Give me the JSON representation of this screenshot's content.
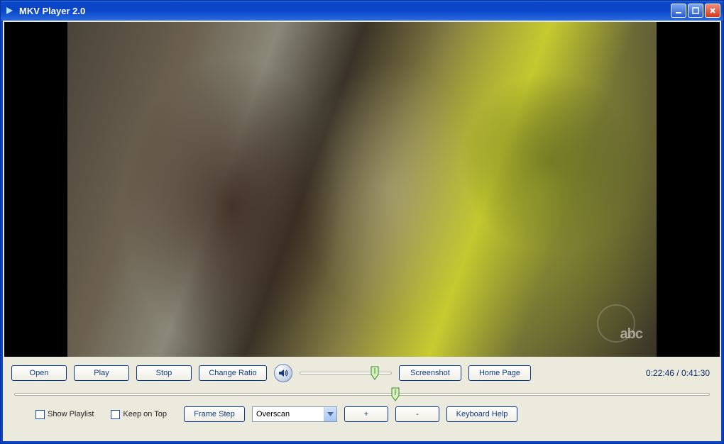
{
  "window": {
    "title": "MKV Player 2.0"
  },
  "controls": {
    "open": "Open",
    "play": "Play",
    "stop": "Stop",
    "change_ratio": "Change Ratio",
    "screenshot": "Screenshot",
    "home_page": "Home Page",
    "frame_step": "Frame Step",
    "plus": "+",
    "minus": "-",
    "keyboard_help": "Keyboard Help"
  },
  "checkboxes": {
    "show_playlist": "Show Playlist",
    "keep_on_top": "Keep on Top"
  },
  "combo": {
    "overscan_selected": "Overscan"
  },
  "time": {
    "current": "0:22:46",
    "separator": " / ",
    "total": "0:41:30"
  },
  "slider": {
    "volume_percent": 85,
    "seek_percent": 54.9
  },
  "watermark": "abc"
}
